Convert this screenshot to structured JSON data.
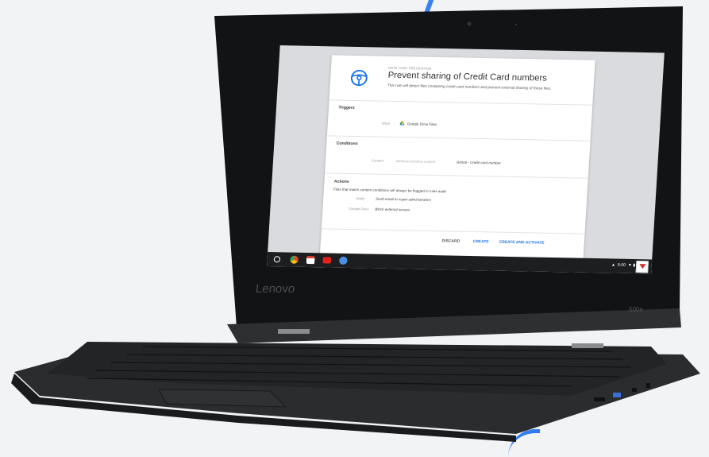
{
  "card": {
    "eyebrow": "DATA LOSS PREVENTION",
    "title": "Prevent sharing of Credit Card numbers",
    "description": "This rule will detect files containing credit card numbers and prevent external sharing of these files.",
    "triggers": {
      "heading": "Triggers",
      "what_label": "What",
      "what_value": "Google Drive Files"
    },
    "conditions": {
      "heading": "Conditions",
      "content_label": "Content",
      "content_value": "Matches sensitive content",
      "detector": "Global - Credit card number"
    },
    "actions": {
      "heading": "Actions",
      "note": "Files that match content conditions will always be flagged in rules audit",
      "notify_label": "Notify",
      "notify_value": "Send email to super administrators",
      "drive_label": "Google Drive",
      "drive_value": "Block external access"
    },
    "buttons": {
      "discard": "DISCARD",
      "create": "CREATE",
      "create_activate": "CREATE AND ACTIVATE"
    }
  },
  "shelf": {
    "time": "8:00"
  },
  "device": {
    "brand": "Lenovo",
    "model": "500e"
  },
  "colors": {
    "accent": "#1a73e8",
    "background_arc": "#2f7bf0"
  }
}
